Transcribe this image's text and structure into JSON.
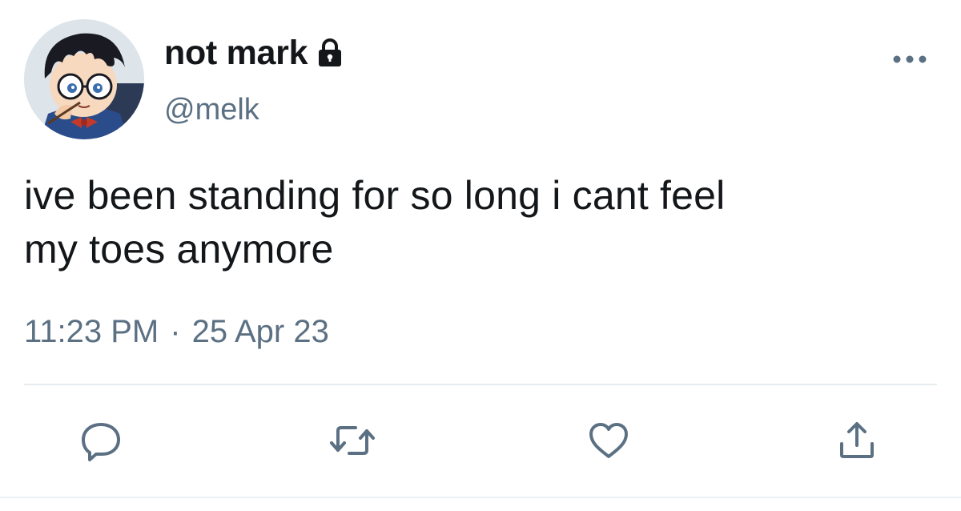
{
  "tweet": {
    "display_name": "not mark",
    "handle": "@melk",
    "protected_icon": "lock-icon",
    "text_line_1": "ive been standing for so long i cant feel",
    "text_line_2": "my toes anymore",
    "time": "11:23 PM",
    "separator": "·",
    "date": "25 Apr 23"
  },
  "icons": {
    "avatar": "avatar-illustration",
    "more": "more-options-icon",
    "reply": "reply-icon",
    "retweet": "retweet-icon",
    "like": "like-icon",
    "share": "share-icon"
  },
  "colors": {
    "text": "#14171a",
    "secondary": "#5b7083",
    "divider": "#e6ecf0"
  }
}
